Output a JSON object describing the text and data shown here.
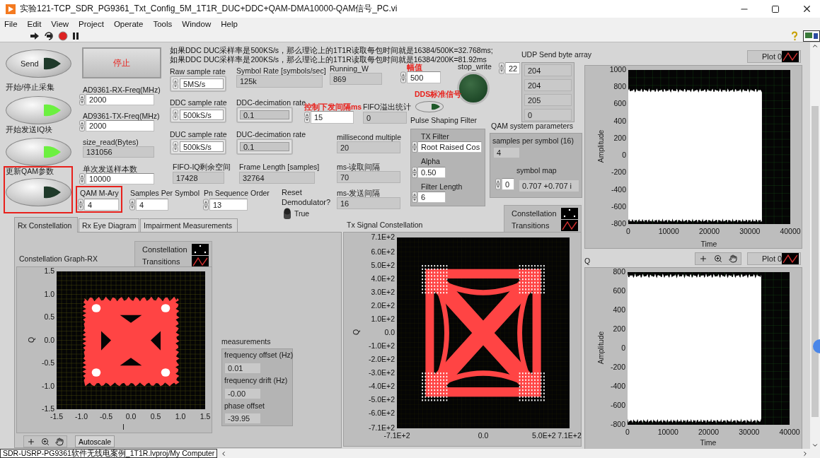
{
  "window": {
    "title": "实验121-TCP_SDR_PG9361_Txt_Config_5M_1T1R_DUC+DDC+QAM-DMA10000-QAM信号_PC.vi"
  },
  "menu": [
    "File",
    "Edit",
    "View",
    "Project",
    "Operate",
    "Tools",
    "Window",
    "Help"
  ],
  "notes": [
    "如果DDC DUC采样率是500KS/s，那么理论上的1T1R读取每包时间就是16384/500K=32.768ms;",
    "如果DDC DUC采样率是200KS/s，那么理论上的1T1R读取每包时间就是16384/200K=81.92ms"
  ],
  "stop_button": {
    "label": "停止"
  },
  "buttons": [
    {
      "text": "Send",
      "on": false,
      "outlined": false
    },
    {
      "label": "开始/停止采集",
      "on": true,
      "outlined": false
    },
    {
      "label": "开始发送IQ块",
      "on": true,
      "outlined": false
    },
    {
      "label": "更新QAM参数",
      "on": false,
      "outlined": true
    }
  ],
  "fields": [
    {
      "label": "AD9361-RX-Freq(MHz)",
      "value": "2000",
      "kind": "control",
      "emphasis": false,
      "outlined": false
    },
    {
      "label": "AD9361-TX-Freq(MHz)",
      "value": "2000",
      "kind": "control",
      "emphasis": false,
      "outlined": false
    },
    {
      "label": "size_read(Bytes)",
      "value": "131056",
      "kind": "indicator",
      "emphasis": false,
      "outlined": false
    },
    {
      "label": "单次发送样本数",
      "value": "10000",
      "kind": "control",
      "emphasis": false,
      "outlined": false
    },
    {
      "label": "QAM M-Ary",
      "value": "4",
      "kind": "control",
      "emphasis": false,
      "outlined": true
    },
    {
      "label": "Samples Per Symbol",
      "value": "4",
      "kind": "control",
      "emphasis": false,
      "outlined": false
    },
    {
      "label": "Pn Sequence Order",
      "value": "13",
      "kind": "control",
      "emphasis": false,
      "outlined": false
    },
    {
      "label": "Raw sample rate",
      "value": "5MS/s",
      "kind": "ring",
      "emphasis": false,
      "outlined": false
    },
    {
      "label": "DDC sample rate",
      "value": "500kS/s",
      "kind": "ring",
      "emphasis": false,
      "outlined": false
    },
    {
      "label": "DUC sample rate",
      "value": "500kS/s",
      "kind": "ring",
      "emphasis": false,
      "outlined": false
    },
    {
      "label": "Symbol Rate [symbols/sec]",
      "value": "125k",
      "kind": "indicator",
      "emphasis": false,
      "outlined": false
    },
    {
      "label": "DDC-decimation rate",
      "value": "0.1",
      "kind": "framed",
      "emphasis": false,
      "outlined": false
    },
    {
      "label": "DUC-decimation rate",
      "value": "0.1",
      "kind": "framed",
      "emphasis": false,
      "outlined": false
    },
    {
      "label": "FIFO-IQ剩余空间",
      "value": "17428",
      "kind": "indicator",
      "emphasis": false,
      "outlined": false
    },
    {
      "label": "Frame Length [samples]",
      "value": "32764",
      "kind": "indicator",
      "emphasis": false,
      "outlined": false
    },
    {
      "label": "Running_W",
      "value": "869",
      "kind": "indicator",
      "emphasis": false,
      "outlined": false
    },
    {
      "label": "控制下发间隔ms",
      "value": "15",
      "kind": "control",
      "emphasis": true,
      "outlined": false
    },
    {
      "label": "FIFO溢出统计",
      "value": "0",
      "kind": "indicator",
      "emphasis": false,
      "outlined": false
    },
    {
      "label": "millisecond multiple",
      "value": "20",
      "kind": "indicator",
      "emphasis": false,
      "outlined": false
    },
    {
      "label": "ms-读取间隔",
      "value": "70",
      "kind": "indicator",
      "emphasis": false,
      "outlined": false
    },
    {
      "label": "ms-发送间隔",
      "value": "16",
      "kind": "indicator",
      "emphasis": false,
      "outlined": false
    },
    {
      "label": "幅值",
      "value": "500",
      "kind": "control",
      "emphasis": true,
      "outlined": false
    }
  ],
  "stop_write": {
    "label": "stop_write",
    "on": false
  },
  "dds_button": {
    "label": "DDS标准信号",
    "on": false
  },
  "reset_demodulator": {
    "label": "Reset Demodulator?",
    "on": true,
    "text": "True"
  },
  "udp_array": {
    "label": "UDP Send byte array",
    "index": "22",
    "values": [
      "204",
      "204",
      "205",
      "0"
    ]
  },
  "pulse_shaping": {
    "label": "Pulse Shaping Filter",
    "fields": [
      {
        "label": "TX Filter",
        "value": "Root Raised Cos"
      },
      {
        "label": "Alpha",
        "value": "0.50"
      },
      {
        "label": "Filter Length",
        "value": "6"
      }
    ]
  },
  "qam_params": {
    "label": "QAM system parameters",
    "samples_label": "samples per symbol (16)",
    "samples_value": "4",
    "symbol_map_label": "symbol map",
    "index": "0",
    "value": "0.707 +0.707 i"
  },
  "tx_legend": [
    {
      "label": "Constellation",
      "kind": "points"
    },
    {
      "label": "Transitions",
      "kind": "line"
    }
  ],
  "tabs": [
    {
      "label": "Rx Constellation",
      "selected": true
    },
    {
      "label": "Rx Eye Diagram",
      "selected": false
    },
    {
      "label": "Impairment Measurements",
      "selected": false
    }
  ],
  "rx_graph": {
    "label": "Constellation Graph-RX",
    "legend": [
      {
        "label": "Constellation",
        "kind": "points"
      },
      {
        "label": "Transitions",
        "kind": "line"
      }
    ],
    "y_ticks": [
      "1.5",
      "1.0",
      "0.5",
      "0.0",
      "-0.5",
      "-1.0",
      "-1.5"
    ],
    "x_ticks": [
      "-1.5",
      "-1.0",
      "-0.5",
      "0.0",
      "0.5",
      "1.0",
      "1.5"
    ],
    "x_axis": "I",
    "y_axis": "Q",
    "autoscale": "Autoscale"
  },
  "measurements": {
    "label": "measurements",
    "items": [
      {
        "label": "frequency offset (Hz)",
        "value": "0.01"
      },
      {
        "label": "frequency drift (Hz)",
        "value": "-0.00"
      },
      {
        "label": "phase offset",
        "value": "-39.95"
      }
    ]
  },
  "tx_graph": {
    "label": "Tx Signal Constellation",
    "y_ticks": [
      "7.1E+2",
      "6.0E+2",
      "5.0E+2",
      "4.0E+2",
      "3.0E+2",
      "2.0E+2",
      "1.0E+2",
      "0.0",
      "-1.0E+2",
      "-2.0E+2",
      "-3.0E+2",
      "-4.0E+2",
      "-5.0E+2",
      "-6.0E+2",
      "-7.1E+2"
    ],
    "x_ticks": [
      "-7.1E+2",
      "0.0",
      "5.0E+2",
      "7.1E+2"
    ],
    "y_axis": "Q"
  },
  "i_graph": {
    "legend": "Plot 0",
    "y_ticks": [
      "1000",
      "800",
      "600",
      "400",
      "200",
      "0",
      "-200",
      "-400",
      "-600",
      "-800"
    ],
    "x_ticks": [
      "0",
      "10000",
      "20000",
      "30000",
      "40000"
    ],
    "x_axis": "Time",
    "y_axis": "Amplitude"
  },
  "q_graph": {
    "label": "Q",
    "legend": "Plot 0",
    "y_ticks": [
      "800",
      "600",
      "400",
      "200",
      "0",
      "-200",
      "-400",
      "-600",
      "-800"
    ],
    "x_ticks": [
      "0",
      "10000",
      "20000",
      "30000",
      "40000"
    ],
    "x_axis": "Time",
    "y_axis": "Amplitude"
  },
  "status_bar": {
    "path": "SDR-USRP-PG9361软件无线电案例_1T1R.lvproj/My Computer"
  }
}
